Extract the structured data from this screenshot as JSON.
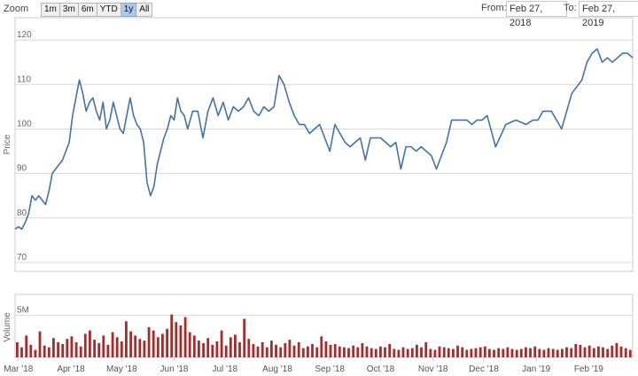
{
  "toolbar": {
    "zoom_label": "Zoom",
    "zoom_buttons": [
      {
        "label": "1m",
        "active": false
      },
      {
        "label": "3m",
        "active": false
      },
      {
        "label": "6m",
        "active": false
      },
      {
        "label": "YTD",
        "active": false
      },
      {
        "label": "1y",
        "active": true
      },
      {
        "label": "All",
        "active": false
      }
    ],
    "from_label": "From:",
    "from_value": "Feb 27, 2018",
    "to_label": "To:",
    "to_value": "Feb 27, 2019"
  },
  "chart_data": [
    {
      "type": "line",
      "ylabel": "Price",
      "ylim": [
        68,
        125
      ],
      "yticks": [
        70,
        80,
        90,
        100,
        110,
        120
      ],
      "grid": true,
      "x_start": "2018-02-27",
      "x_end": "2019-02-27",
      "xticks": [
        "Mar '18",
        "Apr '18",
        "May '18",
        "Jun '18",
        "Jul '18",
        "Aug '18",
        "Sep '18",
        "Oct '18",
        "Nov '18",
        "Dec '18",
        "Jan '19",
        "Feb '19"
      ],
      "line_color": "#4572a7",
      "x": [
        "2018-02-27",
        "2018-03-01",
        "2018-03-03",
        "2018-03-05",
        "2018-03-07",
        "2018-03-09",
        "2018-03-11",
        "2018-03-13",
        "2018-03-15",
        "2018-03-17",
        "2018-03-19",
        "2018-03-21",
        "2018-03-23",
        "2018-03-25",
        "2018-03-27",
        "2018-03-29",
        "2018-03-31",
        "2018-04-02",
        "2018-04-04",
        "2018-04-06",
        "2018-04-08",
        "2018-04-10",
        "2018-04-12",
        "2018-04-14",
        "2018-04-16",
        "2018-04-18",
        "2018-04-20",
        "2018-04-22",
        "2018-04-24",
        "2018-04-26",
        "2018-04-28",
        "2018-04-30",
        "2018-05-02",
        "2018-05-04",
        "2018-05-06",
        "2018-05-08",
        "2018-05-10",
        "2018-05-12",
        "2018-05-14",
        "2018-05-16",
        "2018-05-18",
        "2018-05-20",
        "2018-05-22",
        "2018-05-24",
        "2018-05-26",
        "2018-05-28",
        "2018-05-30",
        "2018-06-01",
        "2018-06-03",
        "2018-06-05",
        "2018-06-07",
        "2018-06-09",
        "2018-06-12",
        "2018-06-15",
        "2018-06-18",
        "2018-06-21",
        "2018-06-24",
        "2018-06-27",
        "2018-06-30",
        "2018-07-03",
        "2018-07-06",
        "2018-07-09",
        "2018-07-12",
        "2018-07-15",
        "2018-07-18",
        "2018-07-21",
        "2018-07-24",
        "2018-07-27",
        "2018-07-30",
        "2018-08-02",
        "2018-08-05",
        "2018-08-08",
        "2018-08-11",
        "2018-08-14",
        "2018-08-17",
        "2018-08-20",
        "2018-08-23",
        "2018-08-26",
        "2018-08-29",
        "2018-09-01",
        "2018-09-04",
        "2018-09-07",
        "2018-09-10",
        "2018-09-13",
        "2018-09-16",
        "2018-09-19",
        "2018-09-22",
        "2018-09-25",
        "2018-09-28",
        "2018-10-01",
        "2018-10-04",
        "2018-10-07",
        "2018-10-10",
        "2018-10-13",
        "2018-10-16",
        "2018-10-19",
        "2018-10-22",
        "2018-10-25",
        "2018-10-28",
        "2018-10-31",
        "2018-11-03",
        "2018-11-06",
        "2018-11-09",
        "2018-11-12",
        "2018-11-15",
        "2018-11-18",
        "2018-11-21",
        "2018-11-24",
        "2018-11-27",
        "2018-11-30",
        "2018-12-03",
        "2018-12-08",
        "2018-12-14",
        "2018-12-20",
        "2018-12-26",
        "2018-12-30",
        "2019-01-02",
        "2019-01-05",
        "2019-01-10",
        "2019-01-16",
        "2019-01-22",
        "2019-01-28",
        "2019-01-31",
        "2019-02-03",
        "2019-02-06",
        "2019-02-09",
        "2019-02-12",
        "2019-02-15",
        "2019-02-18",
        "2019-02-21",
        "2019-02-24",
        "2019-02-27"
      ],
      "values": [
        77.5,
        78,
        77.5,
        79,
        81,
        85,
        84,
        85,
        84,
        83,
        86,
        90,
        91,
        92,
        93,
        95,
        97,
        103,
        107,
        111,
        108,
        104,
        106,
        107,
        104,
        102,
        106,
        100,
        102,
        106,
        103,
        100,
        99,
        103,
        107,
        103,
        101,
        100,
        97,
        88,
        85,
        87,
        92,
        95,
        98,
        100,
        103,
        102,
        107,
        104,
        103,
        100,
        104,
        104,
        98,
        104,
        107,
        103,
        106,
        102,
        105,
        104,
        105,
        107,
        104,
        103,
        105,
        104,
        105,
        112,
        110,
        106,
        103,
        101,
        101,
        99,
        100,
        101,
        98,
        95,
        101,
        99,
        97,
        96,
        97,
        98,
        93,
        98,
        98,
        98,
        97,
        96,
        97,
        91,
        96,
        96,
        95,
        96,
        95,
        94,
        91,
        94,
        97,
        102,
        102,
        102,
        102,
        101,
        102,
        102,
        103,
        96,
        101,
        102,
        101,
        102,
        102,
        104,
        104,
        100,
        108,
        111,
        115,
        117,
        118,
        115,
        116,
        115,
        116,
        117,
        117,
        116
      ],
      "comment": null
    },
    {
      "type": "bar",
      "ylabel": "Volume",
      "ylim": [
        0,
        7500000
      ],
      "yticks": [
        5000000
      ],
      "ytick_labels": [
        "5M"
      ],
      "bar_color": "#aa2a2a",
      "x_start": "2018-02-27",
      "x_end": "2019-02-27",
      "values": [
        1800000,
        1200000,
        2600000,
        1500000,
        900000,
        3100000,
        1400000,
        1200000,
        2300000,
        1800000,
        1600000,
        2200000,
        2500000,
        1800000,
        1300000,
        2800000,
        3200000,
        2100000,
        1700000,
        2600000,
        1500000,
        3000000,
        2400000,
        1900000,
        4300000,
        3100000,
        2600000,
        2200000,
        2000000,
        3600000,
        3200000,
        2400000,
        2800000,
        3400000,
        5100000,
        4200000,
        3800000,
        4800000,
        3000000,
        2600000,
        2000000,
        1700000,
        2300000,
        1500000,
        1900000,
        3200000,
        1400000,
        2400000,
        2700000,
        1800000,
        4600000,
        2200000,
        1600000,
        1300000,
        1800000,
        1200000,
        2000000,
        1500000,
        1200000,
        1700000,
        2100000,
        1400000,
        1800000,
        1100000,
        1300000,
        1600000,
        1200000,
        2500000,
        1900000,
        1500000,
        1600000,
        1300000,
        1200000,
        1100000,
        1400000,
        1200000,
        1700000,
        1300000,
        1100000,
        1000000,
        1300000,
        1200000,
        1600000,
        1000000,
        900000,
        1200000,
        1000000,
        1100000,
        1500000,
        1200000,
        1800000,
        1000000,
        900000,
        1300000,
        1200000,
        1100000,
        1000000,
        1400000,
        1200000,
        900000,
        1000000,
        1100000,
        1200000,
        1300000,
        1000000,
        900000,
        1100000,
        1000000,
        1200000,
        1000000,
        900000,
        1000000,
        1200000,
        1100000,
        1300000,
        1000000,
        900000,
        1100000,
        1000000,
        900000,
        1000000,
        1200000,
        1100000,
        1600000,
        1500000,
        1200000,
        1400000,
        1100000,
        1300000,
        1200000,
        1000000,
        1400000,
        1700000,
        1300000,
        1100000,
        900000
      ]
    }
  ]
}
